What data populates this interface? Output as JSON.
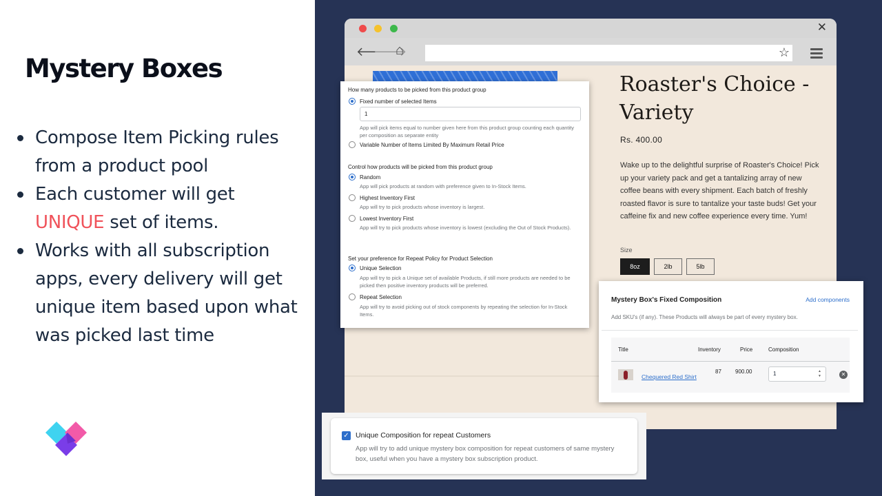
{
  "slide": {
    "title": "Mystery Boxes",
    "bullets": [
      {
        "pre": "Compose Item Picking rules from a product pool",
        "accent": "",
        "post": ""
      },
      {
        "pre": "Each customer will get ",
        "accent": "UNIQUE",
        "post": " set of items."
      },
      {
        "pre": "Works with all subscription apps, every delivery will get unique item based upon what was picked last time",
        "accent": "",
        "post": ""
      }
    ],
    "colors": {
      "accent": "#f0525a",
      "panel": "#263355",
      "text": "#1b2a3f"
    }
  },
  "browser": {
    "icons": [
      "back-arrow-icon",
      "forward-arrow-icon",
      "home-icon",
      "star-icon",
      "hamburger-menu-icon",
      "close-icon"
    ]
  },
  "product": {
    "title": "Roaster's Choice - Variety",
    "price": "Rs. 400.00",
    "description": "Wake up to the delightful surprise of Roaster's Choice! Pick up your variety pack and get a tantalizing array of new coffee beans with every shipment. Each batch of freshly roasted flavor is sure to tantalize your taste buds! Get your caffeine fix and new coffee experience every time. Yum!",
    "size_label": "Size",
    "sizes": [
      "8oz",
      "2lb",
      "5lb"
    ],
    "selected_size": "8oz"
  },
  "picking": {
    "count_heading": "How many products to be picked from this product group",
    "fixed_label": "Fixed number of selected Items",
    "fixed_value": "1",
    "fixed_help": "App will pick items equal to number given here from this product group counting each quantity per composition as separate entity",
    "variable_label": "Variable Number of Items Limited By Maximum Retail Price",
    "control_heading": "Control how products will be picked from this product group",
    "random_label": "Random",
    "random_help": "App will pick products at random with preference given to In-Stock Items.",
    "highest_label": "Highest Inventory First",
    "highest_help": "App will try to pick products whose inventory is largest.",
    "lowest_label": "Lowest Inventory First",
    "lowest_help": "App will try to pick products whose inventory is lowest (excluding the Out of Stock Products).",
    "repeat_heading": "Set your preference for Repeat Policy for Product Selection",
    "unique_label": "Unique Selection",
    "unique_help": "App will try to pick a Unique set of available Products, if still more products are needed to be picked then positive inventory products will be preferred.",
    "repeat_label": "Repeat Selection",
    "repeat_help": "App will try to avoid picking out of stock components by repeating the selection for In-Stock Items."
  },
  "composition": {
    "title": "Mystery Box's Fixed Composition",
    "add_link": "Add components",
    "help": "Add SKU's (if any). These Products will always be part of every mystery box.",
    "columns": {
      "title": "Title",
      "inventory": "Inventory",
      "price": "Price",
      "composition": "Composition"
    },
    "row": {
      "name": "Chequered Red Shirt",
      "inventory": "87",
      "price": "900.00",
      "composition": "1"
    }
  },
  "unique_option": {
    "label": "Unique Composition for repeat Customers",
    "help": "App will try to add unique mystery box composition for repeat customers of same mystery box, useful when you have a mystery box subscription product.",
    "checked": true
  }
}
